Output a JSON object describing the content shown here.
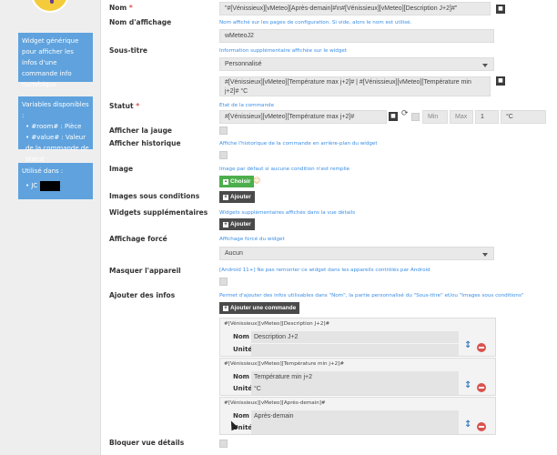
{
  "sidebar": {
    "panel1": "Widget générique pour afficher les infos d'une commande info numérique",
    "panel2": {
      "title": "Variables disponibles :",
      "item1": "#room# : Pièce",
      "item2": "#value# : Valeur de la commande de statut"
    },
    "panel3": {
      "title": "Utilisé dans :",
      "item1": "JC"
    }
  },
  "form": {
    "nom": {
      "label": "Nom",
      "value": "\"#[Vénissieux][vMeteo][Après-demain]#\\n#[Vénissieux][vMeteo][Description J+2]#\""
    },
    "nom_affichage": {
      "label": "Nom d'affichage",
      "help": "Nom affiché sur les pages de configuration. Si vide, alors le nom est utilisé.",
      "value": "wMeteoJ2"
    },
    "sous_titre": {
      "label": "Sous-titre",
      "help": "Information supplémentaire affichée sur le widget",
      "select": "Personnalisé",
      "value": "#[Vénissieux][vMeteo][Température max j+2]# | #[Vénissieux][vMeteo][Température min j+2]# °C"
    },
    "statut": {
      "label": "Statut",
      "help": "Etat de la commande",
      "value": "#[Vénissieux][vMeteo][Température max j+2]#",
      "min_placeholder": "Min",
      "max_placeholder": "Max",
      "step": "1",
      "unit": "°C"
    },
    "jauge": {
      "label": "Afficher la jauge"
    },
    "historique": {
      "label": "Afficher historique",
      "help": "Affiche l'historique de la commande en arrière-plan du widget"
    },
    "image": {
      "label": "Image",
      "help": "Image par défaut si aucune condition n'est remplie",
      "button": "Choisir"
    },
    "images_conditions": {
      "label": "Images sous conditions",
      "button": "Ajouter"
    },
    "widgets_supp": {
      "label": "Widgets supplémentaires",
      "help": "Widgets supplémentaires affichés dans la vue détails",
      "button": "Ajouter"
    },
    "affichage_force": {
      "label": "Affichage forcé",
      "help": "Affichage forcé du widget",
      "select": "Aucun"
    },
    "masquer": {
      "label": "Masquer l'appareil",
      "help": "[Android 11+] Ne pas remonter ce widget dans les appareils contrôlés par Android"
    },
    "ajouter_infos": {
      "label": "Ajouter des infos",
      "help": "Permet d'ajouter des infos utilisables dans \"Nom\", la partie personnalisé du \"Sous-titre\" et/ou \"Images sous conditions\"",
      "button": "Ajouter une commande",
      "nom_label": "Nom :",
      "unite_label": "Unité :",
      "items": [
        {
          "cmd": "#[Vénissieux][vMeteo][Description J+2]#",
          "nom": "Description J+2",
          "unite": ""
        },
        {
          "cmd": "#[Vénissieux][vMeteo][Température min j+2]#",
          "nom": "Température min j+2",
          "unite": "°C"
        },
        {
          "cmd": "#[Vénissieux][vMeteo][Après-demain]#",
          "nom": "Après-demain",
          "unite": ""
        }
      ]
    },
    "bloquer": {
      "label": "Bloquer vue détails"
    }
  }
}
